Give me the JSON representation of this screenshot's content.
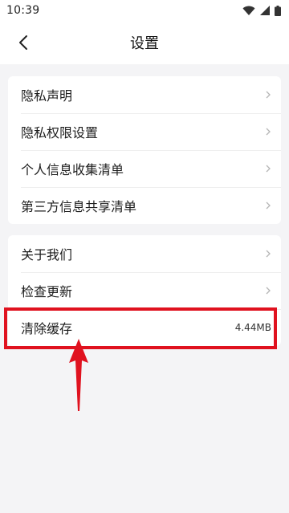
{
  "status_bar": {
    "time": "10:39"
  },
  "header": {
    "title": "设置"
  },
  "card1": {
    "items": [
      {
        "label": "隐私声明"
      },
      {
        "label": "隐私权限设置"
      },
      {
        "label": "个人信息收集清单"
      },
      {
        "label": "第三方信息共享清单"
      }
    ]
  },
  "card2": {
    "items": [
      {
        "label": "关于我们"
      },
      {
        "label": "检查更新"
      },
      {
        "label": "清除缓存",
        "value": "4.44MB"
      }
    ]
  },
  "annotation": {
    "color": "#e0121f"
  },
  "icons": [
    "wifi-icon",
    "signal-icon",
    "battery-icon",
    "back-arrow-icon",
    "chevron-right-icon"
  ]
}
